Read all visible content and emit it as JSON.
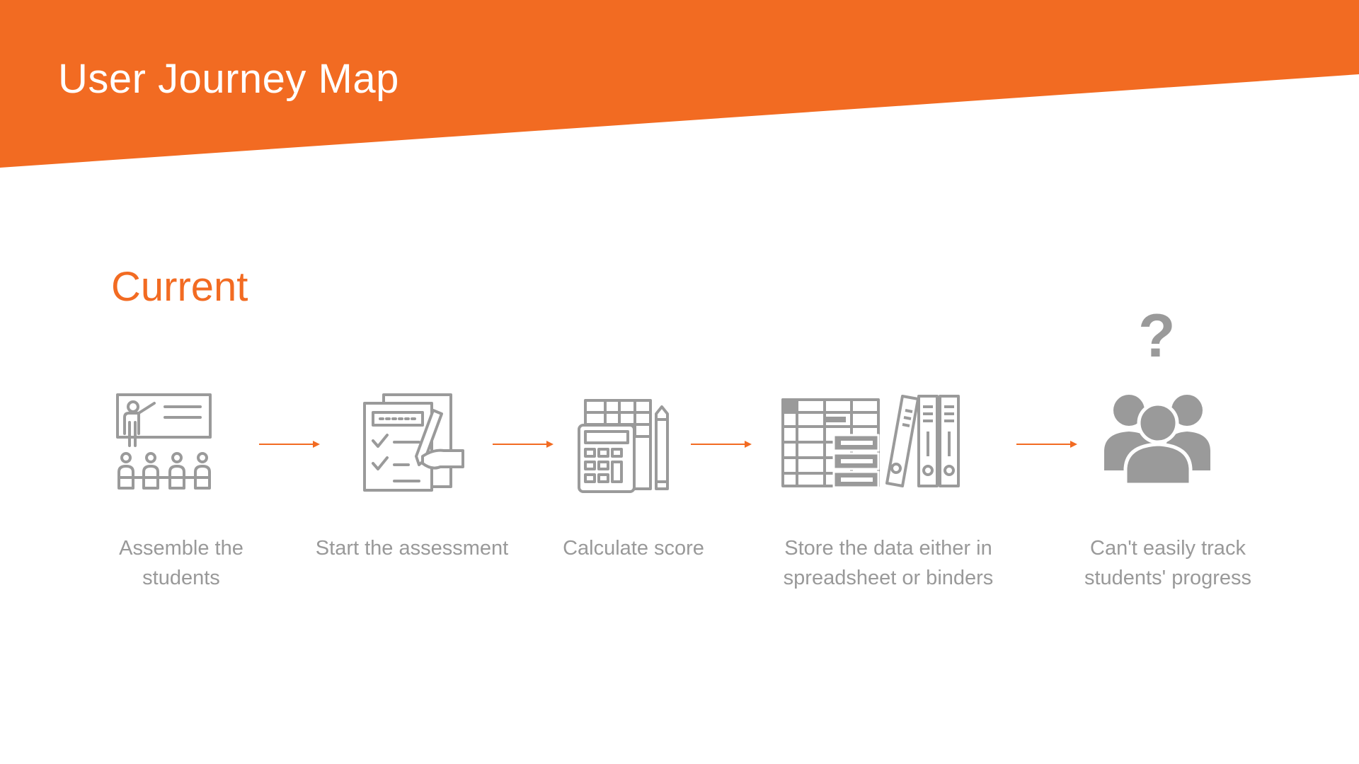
{
  "title": "User Journey Map",
  "section": "Current",
  "colors": {
    "accent": "#f26b22",
    "icon": "#9a9a9a",
    "label": "#999999"
  },
  "steps": [
    {
      "icon": "teacher-classroom-icon",
      "label": "Assemble the students"
    },
    {
      "icon": "assessment-form-icon",
      "label": "Start the assessment"
    },
    {
      "icon": "calculator-icon",
      "label": "Calculate score"
    },
    {
      "icon": "spreadsheet-binders-icon",
      "label": "Store the data either in spreadsheet or binders"
    },
    {
      "icon": "confused-group-icon",
      "label": "Can't easily track students' progress"
    }
  ],
  "question_mark": "?"
}
